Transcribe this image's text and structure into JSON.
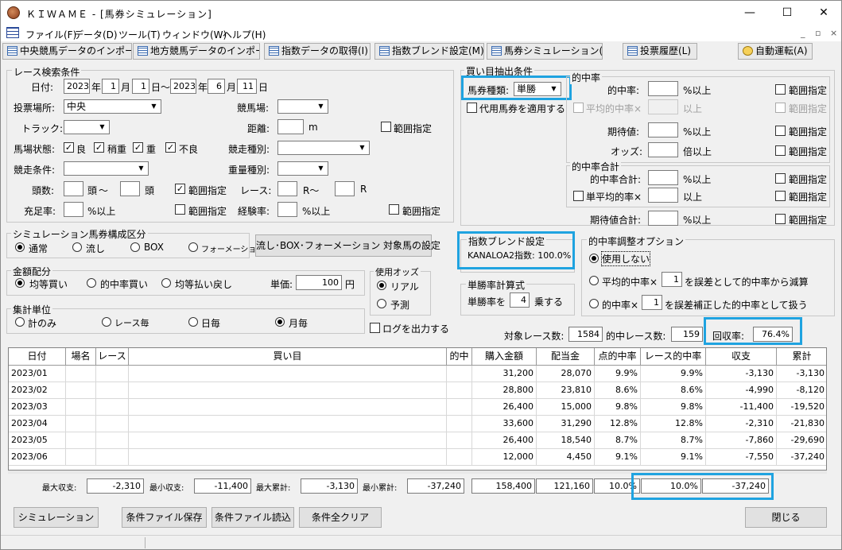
{
  "window": {
    "title": "ＫＩＷＡＭＥ - [馬券シミュレーション]",
    "minimize": "—",
    "maximize": "☐",
    "close": "✕"
  },
  "menu": [
    "ファイル(F)",
    "データ(D)",
    "ツール(T)",
    "ウィンドウ(W)",
    "ヘルプ(H)"
  ],
  "mdi": {
    "min": "_",
    "restore": "▫",
    "close": "×"
  },
  "toolbar": [
    "中央競馬データのインポート(J)",
    "地方競馬データのインポート(N)",
    "指数データの取得(I)",
    "指数ブレンド設定(M)",
    "馬券シミュレーション(B)",
    "投票履歴(L)",
    "自動運転(A)"
  ],
  "race_search": {
    "title": "レース検索条件",
    "date_label": "日付:",
    "y1": "2023",
    "y_unit": "年",
    "m1": "1",
    "m_unit": "月",
    "d1": "1",
    "d_unit": "日",
    "tilde": "～",
    "y2": "2023",
    "m2": "6",
    "d2": "11",
    "venue_label": "投票場所:",
    "venue": "中央",
    "course_label": "競馬場:",
    "track_label": "トラック:",
    "distance_label": "距離:",
    "distance_unit": "m",
    "range": "範囲指定",
    "condition_label": "馬場状態:",
    "conditions": [
      "良",
      "稍重",
      "重",
      "不良"
    ],
    "race_type_label": "競走種別:",
    "race_cond_label": "競走条件:",
    "weight_label": "重量種別:",
    "heads_label": "頭数:",
    "heads_unit": "頭",
    "heads_tilde": "～",
    "race_label": "レース:",
    "race_unit": "R",
    "race_tilde": "R～",
    "fill_label": "充足率:",
    "pct_above": "%以上",
    "exp_label": "経験率:"
  },
  "sim_type": {
    "title": "シミュレーション馬券構成区分",
    "options": [
      "通常",
      "流し",
      "BOX",
      "フォーメーション"
    ],
    "button": "流し･BOX･フォーメーション 対象馬の設定"
  },
  "money": {
    "title": "金額配分",
    "options": [
      "均等買い",
      "的中率買い",
      "均等払い戻し"
    ],
    "unit_label": "単価:",
    "unit": "100",
    "yen": "円"
  },
  "odds": {
    "title": "使用オッズ",
    "options": [
      "リアル",
      "予測"
    ]
  },
  "agg": {
    "title": "集計単位",
    "options": [
      "計のみ",
      "レース毎",
      "日毎",
      "月毎"
    ]
  },
  "log": "ログを出力する",
  "extract": {
    "title": "買い目抽出条件",
    "ticket_label": "馬券種類:",
    "ticket": "単勝",
    "substitute": "代用馬券を適用する",
    "hit_rate_group": "的中率",
    "hit_rate": "的中率:",
    "pct_above": "%以上",
    "avg_hit": "平均的中率×",
    "above": "以上",
    "range": "範囲指定",
    "expected": "期待値:",
    "odds": "オッズ:",
    "times_above": "倍以上",
    "total_group": "的中率合計",
    "hit_total": "的中率合計:",
    "single_avg": "単平均的率×",
    "exp_total": "期待値合計:"
  },
  "blend": {
    "title": "指数ブレンド設定",
    "value": "KANALOA2指数: 100.0%"
  },
  "winrate": {
    "title": "単勝率計算式",
    "pre": "単勝率を",
    "value": "4",
    "post": "乗する"
  },
  "adjust": {
    "title": "的中率調整オプション",
    "opt1": "使用しない",
    "opt2_pre": "平均的中率×",
    "opt2_val": "1",
    "opt2_post": "を誤差として的中率から減算",
    "opt3_pre": "的中率×",
    "opt3_val": "1",
    "opt3_post": "を誤差補正した的中率として扱う"
  },
  "stats": {
    "races_label": "対象レース数:",
    "races": "1584",
    "hit_label": "的中レース数:",
    "hit": "159",
    "recovery_label": "回収率:",
    "recovery": "76.4%"
  },
  "table": {
    "headers": [
      "日付",
      "場名",
      "レース",
      "買い目",
      "的中",
      "購入金額",
      "配当金",
      "点的中率",
      "レース的中率",
      "収支",
      "累計"
    ],
    "rows": [
      [
        "2023/01",
        "",
        "",
        "",
        "",
        "31,200",
        "28,070",
        "9.9%",
        "9.9%",
        "-3,130",
        "-3,130"
      ],
      [
        "2023/02",
        "",
        "",
        "",
        "",
        "28,800",
        "23,810",
        "8.6%",
        "8.6%",
        "-4,990",
        "-8,120"
      ],
      [
        "2023/03",
        "",
        "",
        "",
        "",
        "26,400",
        "15,000",
        "9.8%",
        "9.8%",
        "-11,400",
        "-19,520"
      ],
      [
        "2023/04",
        "",
        "",
        "",
        "",
        "33,600",
        "31,290",
        "12.8%",
        "12.8%",
        "-2,310",
        "-21,830"
      ],
      [
        "2023/05",
        "",
        "",
        "",
        "",
        "26,400",
        "18,540",
        "8.7%",
        "8.7%",
        "-7,860",
        "-29,690"
      ],
      [
        "2023/06",
        "",
        "",
        "",
        "",
        "12,000",
        "4,450",
        "9.1%",
        "9.1%",
        "-7,550",
        "-37,240"
      ]
    ]
  },
  "summary": {
    "max_balance_label": "最大収支:",
    "max_balance": "-2,310",
    "min_balance_label": "最小収支:",
    "min_balance": "-11,400",
    "max_cum_label": "最大累計:",
    "max_cum": "-3,130",
    "min_cum_label": "最小累計:",
    "min_cum": "-37,240",
    "purchase": "158,400",
    "payout": "121,160",
    "point_rate": "10.0%",
    "race_rate": "10.0%",
    "cum": "-37,240"
  },
  "buttons": {
    "simulate": "シミュレーション",
    "save": "条件ファイル保存",
    "load": "条件ファイル読込",
    "clear": "条件全クリア",
    "close": "閉じる"
  },
  "colors": {
    "highlight": "#1fa3e0"
  }
}
